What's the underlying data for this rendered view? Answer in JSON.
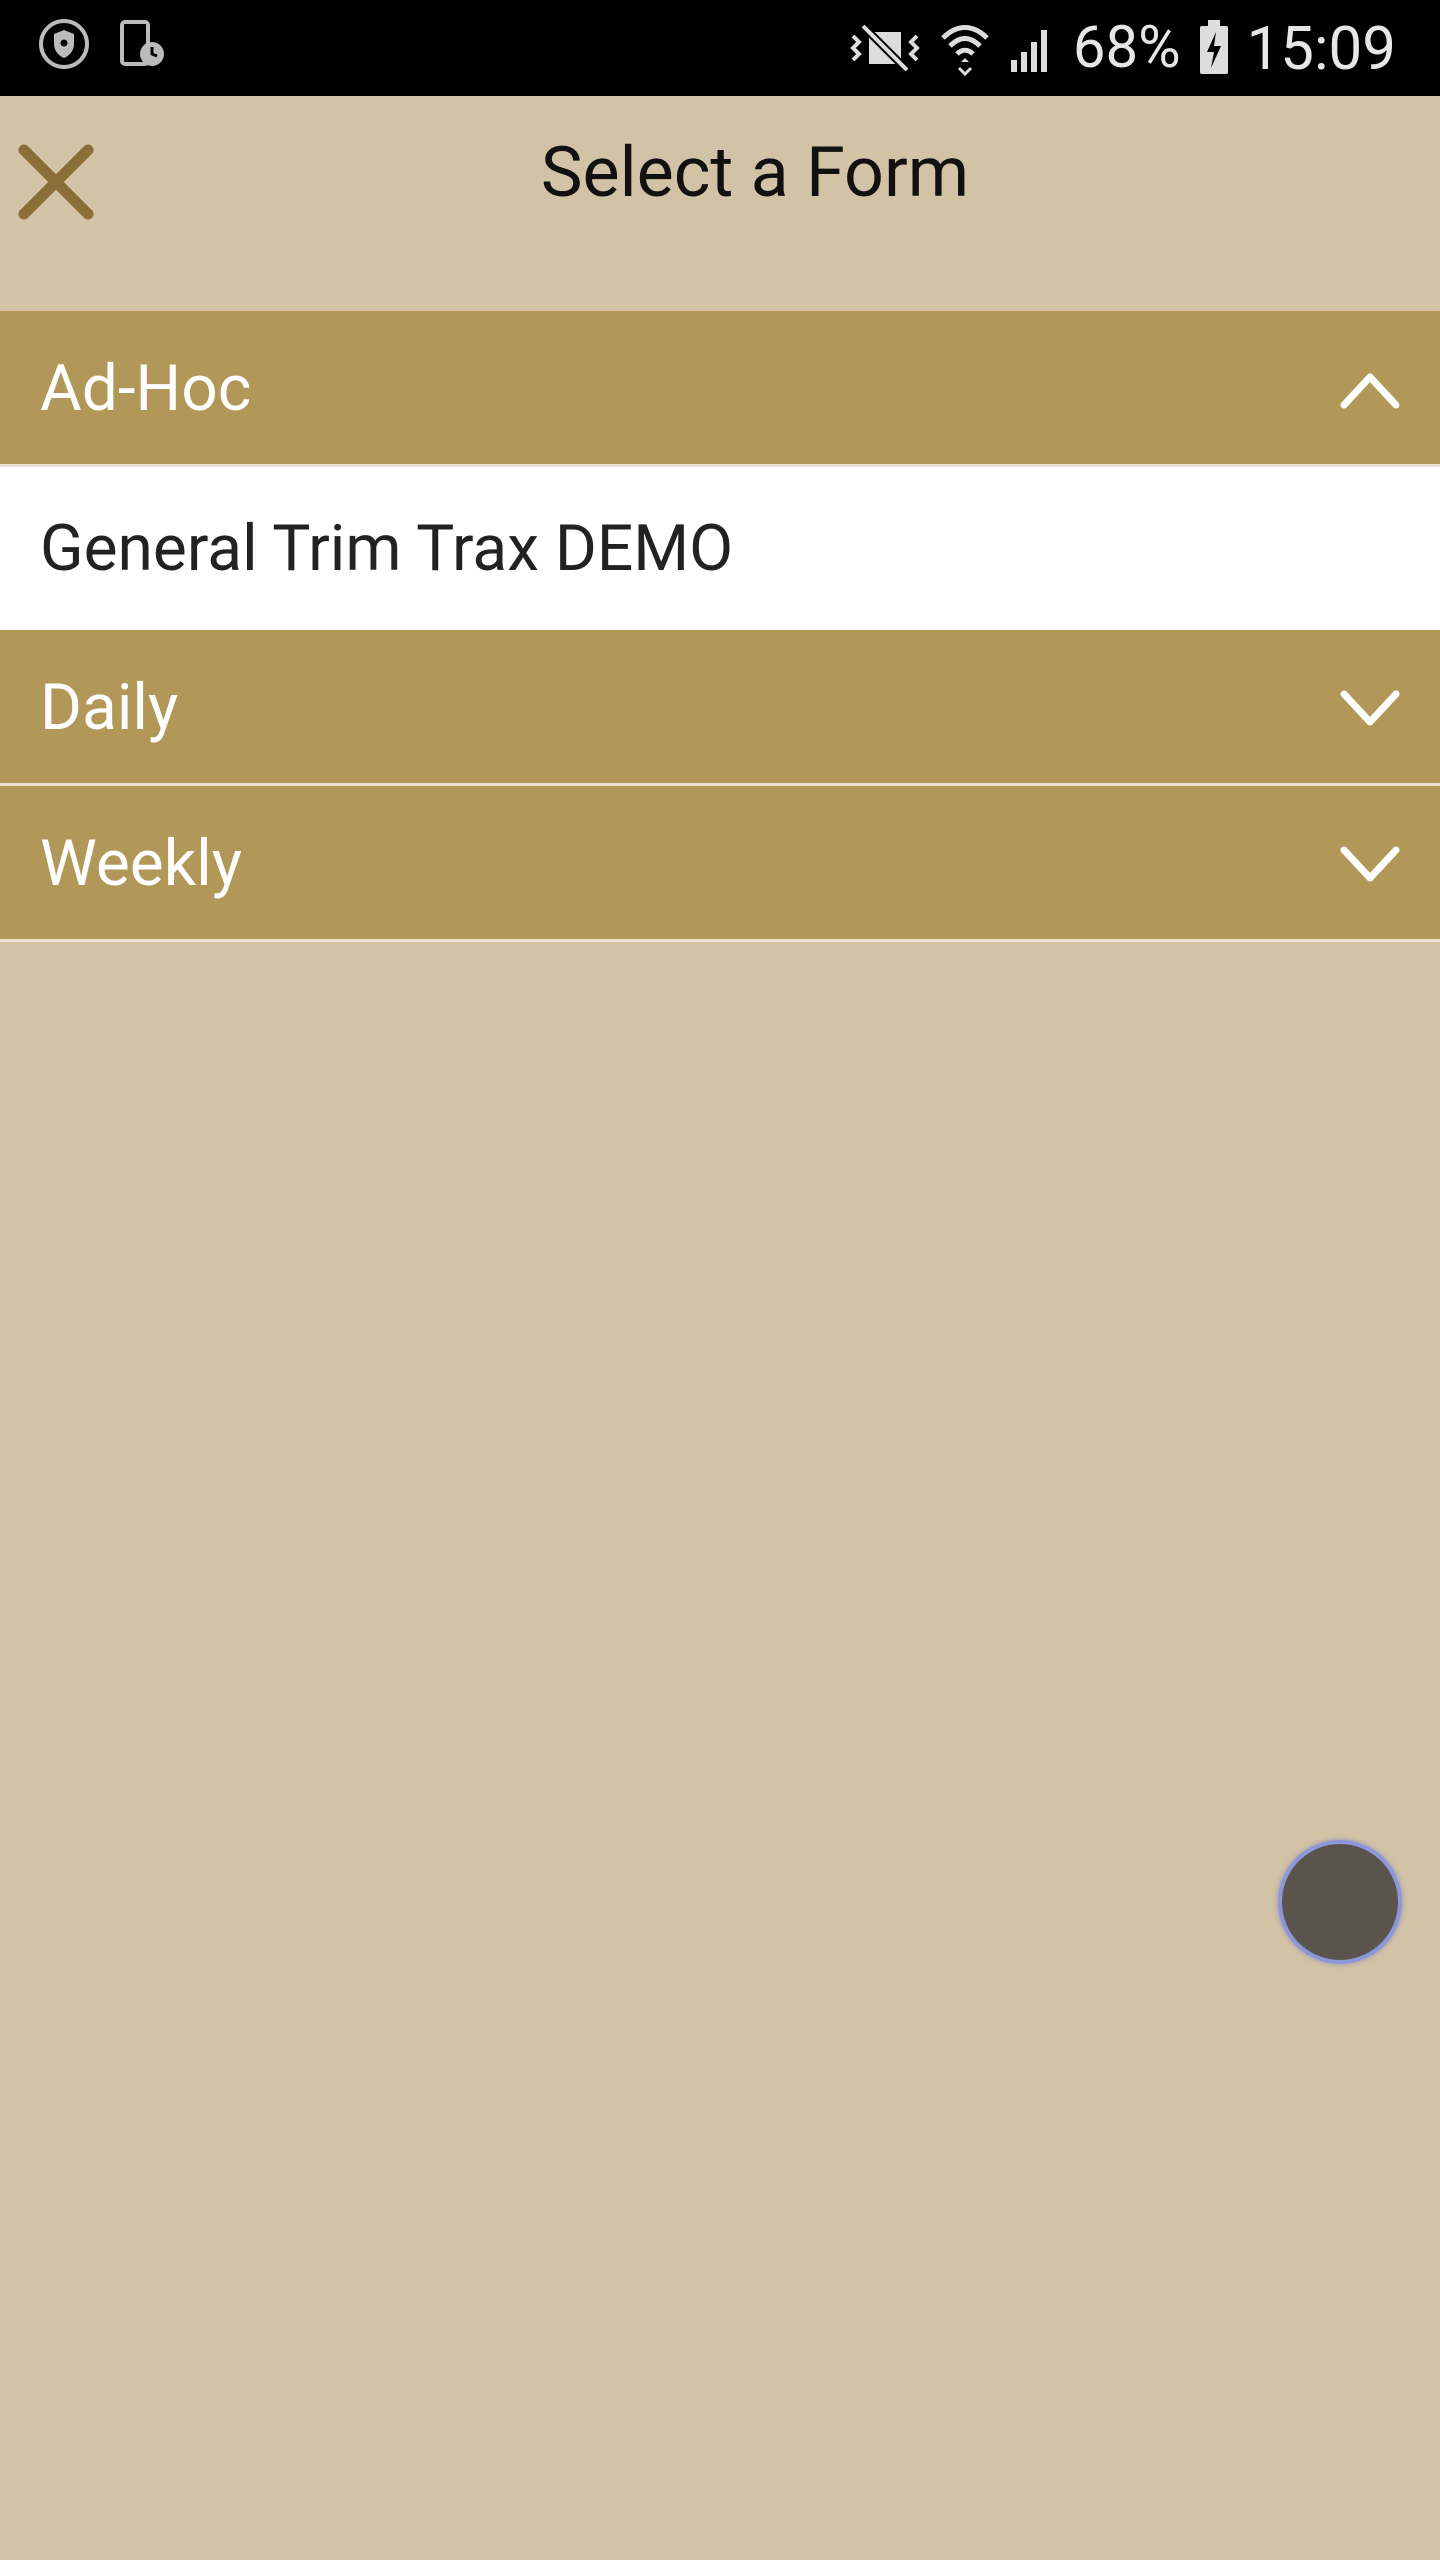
{
  "status_bar": {
    "battery": "68%",
    "time": "15:09",
    "icons": [
      "shield-icon",
      "device-clock-icon",
      "mute-vibrate-icon",
      "wifi-icon",
      "signal-icon",
      "battery-icon"
    ]
  },
  "header": {
    "title": "Select a Form",
    "close_icon": "close-icon"
  },
  "accordion": {
    "sections": [
      {
        "label": "Ad-Hoc",
        "expanded": true,
        "items": [
          "General Trim Trax DEMO"
        ]
      },
      {
        "label": "Daily",
        "expanded": false,
        "items": []
      },
      {
        "label": "Weekly",
        "expanded": false,
        "items": []
      }
    ]
  },
  "colors": {
    "background": "#d3c3a6",
    "section_header": "#b29858",
    "accent_close": "#8a6f38",
    "fab": "#5a544d",
    "fab_ring": "#8c97d9"
  }
}
